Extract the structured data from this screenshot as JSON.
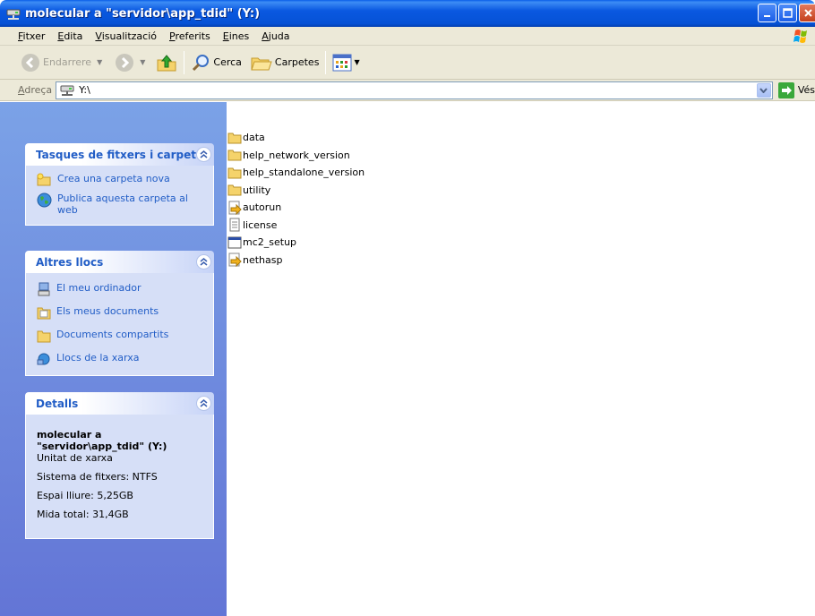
{
  "window": {
    "title": "molecular a \"servidor\\app_tdid\" (Y:)"
  },
  "menu": [
    "Fitxer",
    "Edita",
    "Visualització",
    "Preferits",
    "Eines",
    "Ajuda"
  ],
  "toolbar": {
    "back_label": "Endarrere",
    "search_label": "Cerca",
    "folders_label": "Carpetes"
  },
  "address": {
    "label": "Adreça",
    "value": "Y:\\",
    "go_label": "Vés"
  },
  "tasks": {
    "title": "Tasques de fitxers i carpet",
    "items": [
      "Crea una carpeta nova",
      "Publica aquesta carpeta al web"
    ]
  },
  "other_places": {
    "title": "Altres llocs",
    "items": [
      "El meu ordinador",
      "Els meus documents",
      "Documents compartits",
      "Llocs de la xarxa"
    ]
  },
  "details": {
    "title": "Detalls",
    "name": "molecular a \"servidor\\app_tdid\" (Y:)",
    "type": "Unitat de xarxa",
    "filesystem": "Sistema de fitxers: NTFS",
    "free": "Espai lliure: 5,25GB",
    "total": "Mida total: 31,4GB"
  },
  "files": [
    {
      "name": "data",
      "icon": "folder-icon"
    },
    {
      "name": "help_network_version",
      "icon": "folder-icon"
    },
    {
      "name": "help_standalone_version",
      "icon": "folder-icon"
    },
    {
      "name": "utility",
      "icon": "folder-icon"
    },
    {
      "name": "autorun",
      "icon": "setup-file-icon"
    },
    {
      "name": "license",
      "icon": "text-file-icon"
    },
    {
      "name": "mc2_setup",
      "icon": "application-icon"
    },
    {
      "name": "nethasp",
      "icon": "setup-file-icon"
    }
  ],
  "colors": {
    "titlebar": "#0a58e0",
    "taskpane": "#7ba2e7",
    "link": "#215dc6"
  }
}
